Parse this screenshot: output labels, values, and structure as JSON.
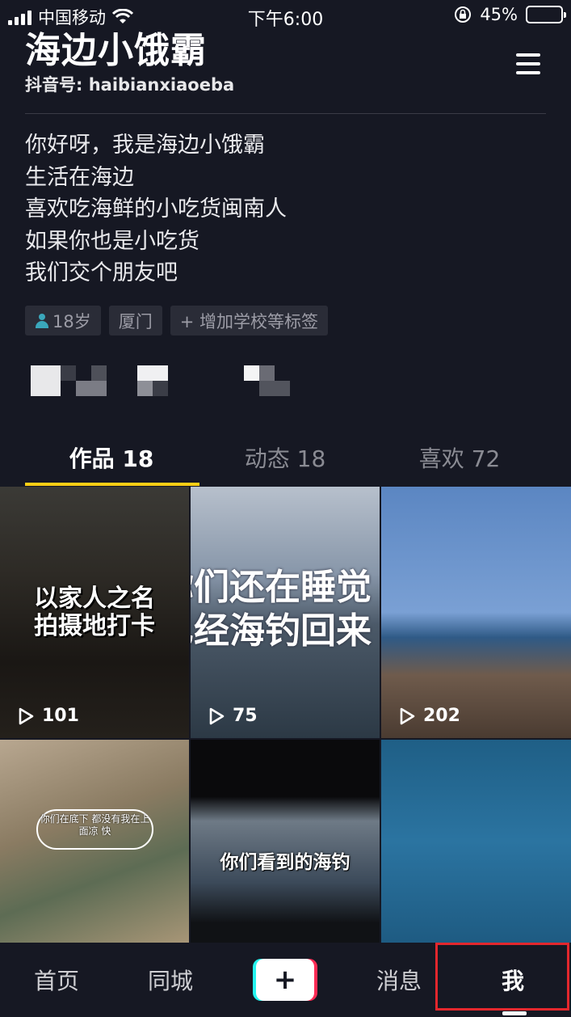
{
  "status_bar": {
    "carrier": "中国移动",
    "time": "下午6:00",
    "battery": "45%",
    "battery_level": 0.45
  },
  "profile": {
    "name": "海边小饿霸",
    "douyin_id": "抖音号: haibianxiaoeba",
    "bio": [
      "你好呀，我是海边小饿霸",
      "生活在海边",
      "喜欢吃海鲜的小吃货闽南人",
      "如果你也是小吃货",
      "我们交个朋友吧"
    ],
    "tags": {
      "age": "18岁",
      "city": "厦门",
      "add": "+ 增加学校等标签"
    }
  },
  "tabs": {
    "works": "作品 18",
    "dynamic": "动态 18",
    "likes": "喜欢 72"
  },
  "videos": [
    {
      "overlay": "以家人之名\n拍摄地打卡",
      "plays": "101"
    },
    {
      "overlay": "你们还在睡觉\n已经海钓回来",
      "plays": "75"
    },
    {
      "overlay": "",
      "plays": "202"
    },
    {
      "overlay": "你们在底下\n都没有我在上面凉\n快",
      "plays": ""
    },
    {
      "overlay": "你们看到的海钓",
      "plays": ""
    },
    {
      "overlay": "",
      "plays": ""
    }
  ],
  "nav": {
    "home": "首页",
    "city": "同城",
    "add": "+",
    "messages": "消息",
    "me": "我"
  },
  "colors": {
    "background": "#161823",
    "tab_indicator": "#face15",
    "highlight": "#e3272d"
  }
}
